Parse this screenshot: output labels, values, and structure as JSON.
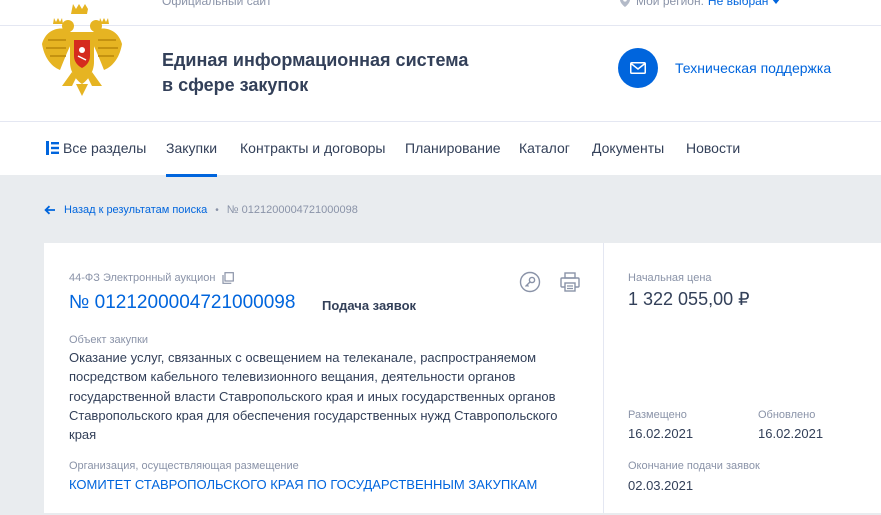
{
  "header": {
    "official_site": "Официальный сайт",
    "region_label": "Мой регион:",
    "region_value": "Не выбран",
    "title_line1": "Единая информационная система",
    "title_line2": "в сфере закупок",
    "support_label": "Техническая поддержка",
    "icons": {
      "emblem": "coat-of-arms-emblem",
      "region": "location-pin-icon",
      "support": "envelope-icon"
    }
  },
  "nav": {
    "items": [
      {
        "label": "Все разделы",
        "icon": "menu-icon"
      },
      {
        "label": "Закупки",
        "active": true
      },
      {
        "label": "Контракты и договоры"
      },
      {
        "label": "Планирование"
      },
      {
        "label": "Каталог"
      },
      {
        "label": "Документы"
      },
      {
        "label": "Новости"
      }
    ]
  },
  "breadcrumb": {
    "back_label": "Назад к результатам поиска",
    "separator": "•",
    "current": "№ 0121200004721000098"
  },
  "card": {
    "law_type": "44-ФЗ Электронный аукцион",
    "number": "№ 0121200004721000098",
    "stage": "Подача заявок",
    "object_label": "Объект закупки",
    "object_text": "Оказание услуг, связанных с освещением на телеканале, распространяемом посредством кабельного телевизионного вещания, деятельности органов государственной власти Ставропольского края и иных государственных органов Ставропольского края для обеспечения государственных нужд Ставропольского края",
    "org_label": "Организация, осуществляющая размещение",
    "org_name": "КОМИТЕТ СТАВРОПОЛЬСКОГО КРАЯ ПО ГОСУДАРСТВЕННЫМ ЗАКУПКАМ",
    "price_label": "Начальная цена",
    "price": "1 322 055,00 ₽",
    "placed_label": "Размещено",
    "placed": "16.02.2021",
    "updated_label": "Обновлено",
    "updated": "16.02.2021",
    "end_label": "Окончание подачи заявок",
    "end": "02.03.2021",
    "icons": [
      "copy-icon",
      "key-icon",
      "print-icon"
    ]
  },
  "colors": {
    "accent": "#0065dd",
    "text": "#334059",
    "muted": "#8a93a8",
    "page_bg": "#e9ecef",
    "emblem_gold": "#e6b422",
    "emblem_red": "#d52b1e"
  }
}
